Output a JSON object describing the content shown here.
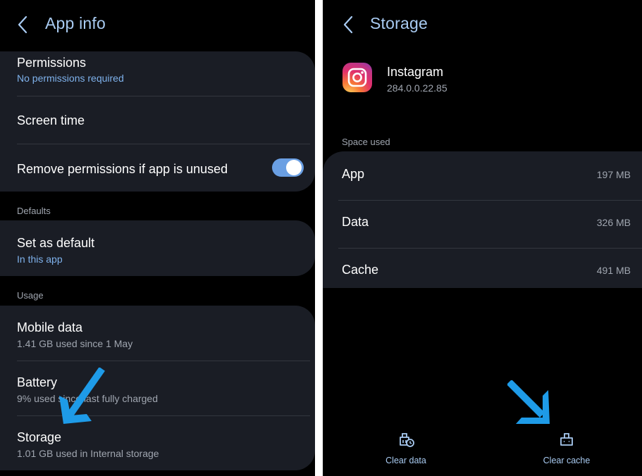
{
  "left": {
    "title": "App info",
    "permissions": {
      "title": "Permissions",
      "sub": "No permissions required"
    },
    "screen_time": {
      "title": "Screen time"
    },
    "remove_permissions": {
      "title": "Remove permissions if app is unused",
      "toggle_on": true
    },
    "defaults_label": "Defaults",
    "set_default": {
      "title": "Set as default",
      "sub": "In this app"
    },
    "usage_label": "Usage",
    "mobile_data": {
      "title": "Mobile data",
      "sub": "1.41 GB used since 1 May"
    },
    "battery": {
      "title": "Battery",
      "sub": "9% used since last fully charged"
    },
    "storage": {
      "title": "Storage",
      "sub": "1.01 GB used in Internal storage"
    }
  },
  "right": {
    "title": "Storage",
    "app": {
      "name": "Instagram",
      "version": "284.0.0.22.85"
    },
    "space_used_label": "Space used",
    "rows": [
      {
        "label": "App",
        "value": "197 MB"
      },
      {
        "label": "Data",
        "value": "326 MB"
      },
      {
        "label": "Cache",
        "value": "491 MB"
      }
    ],
    "buttons": {
      "clear_data": "Clear data",
      "clear_cache": "Clear cache"
    }
  },
  "colors": {
    "title_blue": "#a9cbf2",
    "link_blue": "#7fb2ec",
    "toggle_blue": "#6a9fe3",
    "card_bg": "#1a1d25",
    "annotation_arrow": "#1e9be8"
  },
  "icons": [
    "back-arrow-icon",
    "instagram-icon",
    "clear-data-icon",
    "clear-cache-icon",
    "annotation-arrow-icon"
  ]
}
